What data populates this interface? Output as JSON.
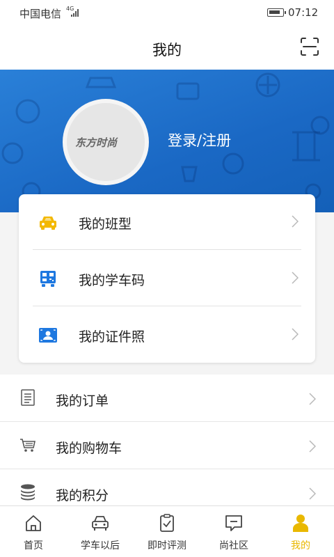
{
  "status_bar": {
    "carrier": "中国电信",
    "network": "4G",
    "time": "07:12"
  },
  "header": {
    "title": "我的",
    "scan_icon": "scan-icon"
  },
  "profile": {
    "avatar_logo_text": "东方时尚",
    "login_label": "登录/注册"
  },
  "colors": {
    "accent_blue": "#1a68c4",
    "active_tab": "#e9b800",
    "car_yellow": "#f3b800",
    "icon_blue": "#1e78e0"
  },
  "card": {
    "items": [
      {
        "label": "我的班型",
        "icon": "car-icon"
      },
      {
        "label": "我的学车码",
        "icon": "qr-code-icon"
      },
      {
        "label": "我的证件照",
        "icon": "id-photo-icon"
      }
    ]
  },
  "menu": {
    "items": [
      {
        "label": "我的订单",
        "icon": "order-icon"
      },
      {
        "label": "我的购物车",
        "icon": "cart-icon"
      },
      {
        "label": "我的积分",
        "icon": "points-icon"
      }
    ]
  },
  "tabs": [
    {
      "label": "首页",
      "icon": "home-icon"
    },
    {
      "label": "学车以后",
      "icon": "car-outline-icon"
    },
    {
      "label": "即时评测",
      "icon": "clipboard-check-icon"
    },
    {
      "label": "尚社区",
      "icon": "chat-icon"
    },
    {
      "label": "我的",
      "icon": "person-icon",
      "active": true
    }
  ]
}
